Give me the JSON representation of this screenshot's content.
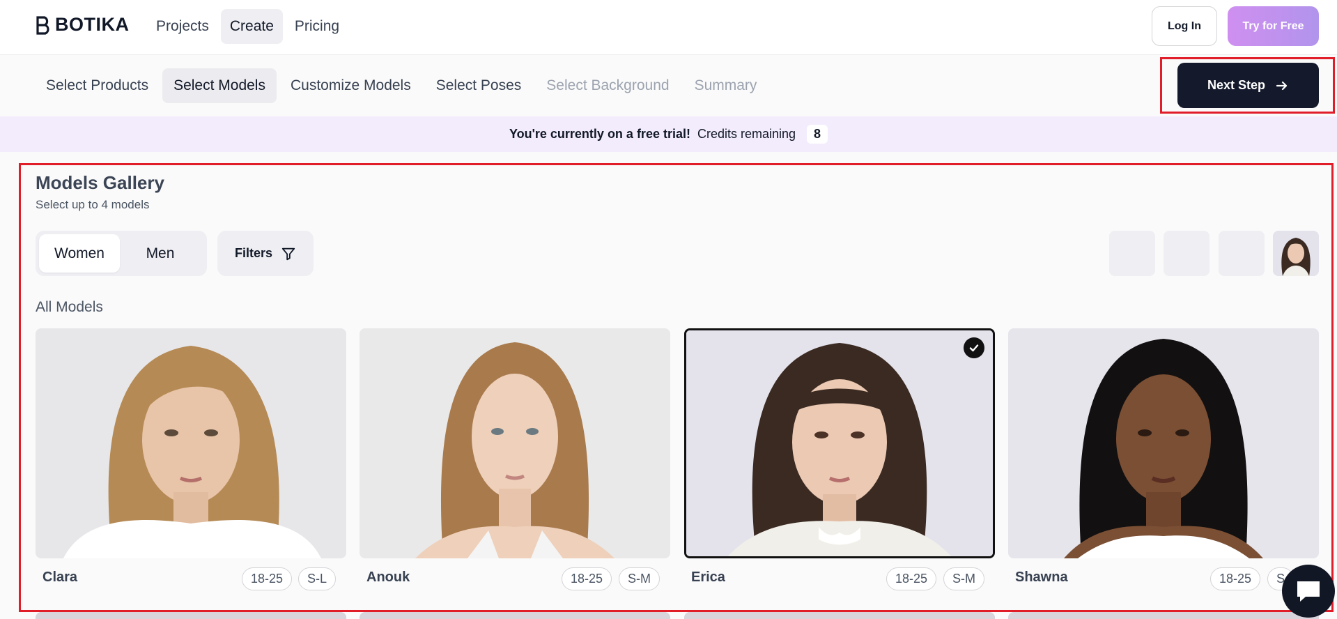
{
  "brand": {
    "name": "BOTIKA"
  },
  "nav": {
    "items": [
      {
        "label": "Projects"
      },
      {
        "label": "Create"
      },
      {
        "label": "Pricing"
      }
    ]
  },
  "auth": {
    "login_label": "Log In",
    "try_label": "Try for Free"
  },
  "steps": [
    {
      "label": "Select Products"
    },
    {
      "label": "Select Models"
    },
    {
      "label": "Customize Models"
    },
    {
      "label": "Select Poses"
    },
    {
      "label": "Select Background"
    },
    {
      "label": "Summary"
    }
  ],
  "next_step": {
    "label": "Next Step",
    "icon": "arrow-right-icon"
  },
  "banner": {
    "message": "You're currently on a free trial!",
    "credits_label": "Credits remaining",
    "credits_value": "8"
  },
  "gallery": {
    "title": "Models Gallery",
    "subtitle": "Select up to 4 models",
    "tabs": [
      {
        "label": "Women"
      },
      {
        "label": "Men"
      }
    ],
    "filters_label": "Filters",
    "section_label": "All Models",
    "selected_slots": 4,
    "selected_count": 1
  },
  "models": [
    {
      "name": "Clara",
      "age": "18-25",
      "size": "S-L",
      "selected": false,
      "hair": "#b58a55",
      "skin": "#e8c4a8",
      "top": "#ffffff",
      "bg": "#e7e7ea"
    },
    {
      "name": "Anouk",
      "age": "18-25",
      "size": "S-M",
      "selected": false,
      "hair": "#a87a4c",
      "skin": "#efd0ba",
      "top": "#f4f4f4",
      "bg": "#e9e9ea"
    },
    {
      "name": "Erica",
      "age": "18-25",
      "size": "S-M",
      "selected": true,
      "hair": "#3a2a22",
      "skin": "#ecc9b3",
      "top": "#f1efe9",
      "bg": "#e4e3ec"
    },
    {
      "name": "Shawna",
      "age": "18-25",
      "size": "S",
      "selected": false,
      "hair": "#121010",
      "skin": "#7b4f34",
      "top": "#ffffff",
      "bg": "#e6e5ec"
    }
  ]
}
